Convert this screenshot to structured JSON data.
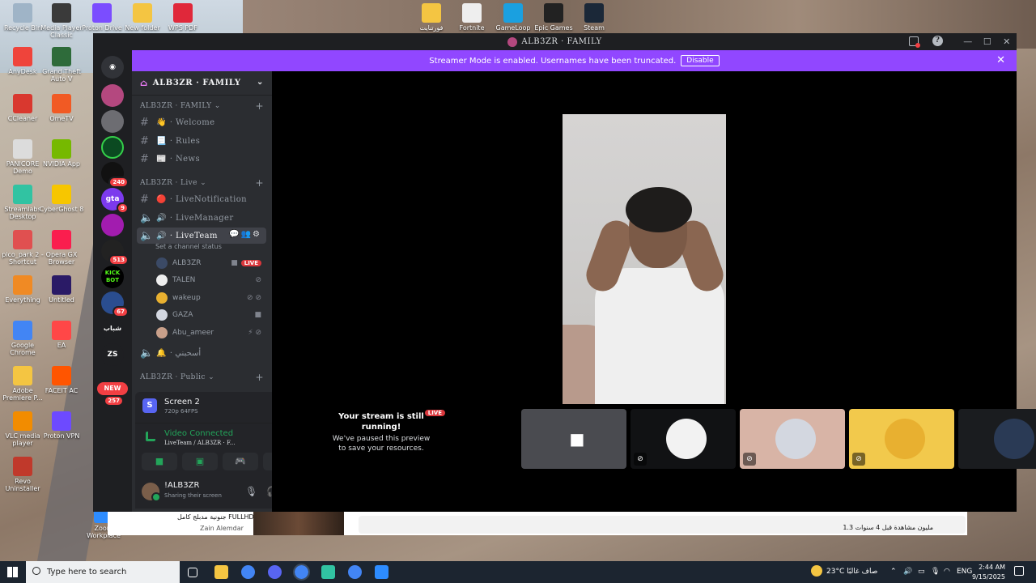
{
  "desktop": {
    "icons": [
      {
        "label": "Recycle Bin",
        "color": "#9fb4c7"
      },
      {
        "label": "Media Player Classic",
        "color": "#3a3a3a"
      },
      {
        "label": "Proton Drive",
        "color": "#7b4dff"
      },
      {
        "label": "New folder",
        "color": "#f4c542"
      },
      {
        "label": "WPS PDF",
        "color": "#e0283a"
      },
      {
        "label": "AnyDesk",
        "color": "#ef443b"
      },
      {
        "label": "Grand Theft Auto V",
        "color": "#2e6b3a"
      },
      {
        "label": "CCleaner",
        "color": "#d9382f"
      },
      {
        "label": "OmeTV",
        "color": "#f15a24"
      },
      {
        "label": "PANICORE Demo",
        "color": "#dcdcdc"
      },
      {
        "label": "NVIDIA App",
        "color": "#76b900"
      },
      {
        "label": "Streamlabs Desktop",
        "color": "#31c3a2"
      },
      {
        "label": "CyberGhost 8",
        "color": "#f7c600"
      },
      {
        "label": "pico_park 2 - Shortcut",
        "color": "#e05050"
      },
      {
        "label": "Opera GX Browser",
        "color": "#fa1e4e"
      },
      {
        "label": "Everything",
        "color": "#f08a24"
      },
      {
        "label": "Untitled",
        "color": "#2a1a66"
      },
      {
        "label": "Google Chrome",
        "color": "#4285f4"
      },
      {
        "label": "EA",
        "color": "#ff4747"
      },
      {
        "label": "Adobe Premiere P...",
        "color": "#f4c542"
      },
      {
        "label": "FACEIT AC",
        "color": "#ff5500"
      },
      {
        "label": "VLC media player",
        "color": "#f28c00"
      },
      {
        "label": "Proton VPN",
        "color": "#6d4aff"
      },
      {
        "label": "Revo Uninstaller",
        "color": "#c0392b"
      },
      {
        "label": "Zoom Workplace",
        "color": "#2d8cff"
      },
      {
        "label": "فورتنايت",
        "color": "#f4c542"
      },
      {
        "label": "Fortnite",
        "color": "#eeeeee"
      },
      {
        "label": "GameLoop",
        "color": "#1aa0e0"
      },
      {
        "label": "Epic Games",
        "color": "#222222"
      },
      {
        "label": "Steam",
        "color": "#1b2838"
      }
    ]
  },
  "window": {
    "title": "ALB3ZR · FAMILY",
    "banner_text": "Streamer Mode is enabled. Usernames have been truncated.",
    "banner_button": "Disable",
    "accent": "#9147ff"
  },
  "rail": {
    "badges": [
      "240",
      "9",
      "513",
      "67",
      "257"
    ],
    "new_label": "NEW",
    "text_guilds": [
      "KICK BOT",
      "شباب",
      "ZS"
    ]
  },
  "server": {
    "name": "ALB3ZR · FAMILY",
    "categories": [
      {
        "label": "ALB3ZR · FAMILY"
      },
      {
        "label": "ALB3ZR · Live"
      },
      {
        "label": "ALB3ZR · Public"
      }
    ],
    "channels": [
      {
        "label": "· Welcome",
        "emoji": "👋"
      },
      {
        "label": "· Rules",
        "emoji": "📃"
      },
      {
        "label": "· News",
        "emoji": "📰"
      },
      {
        "label": "· LiveNotification",
        "emoji": "🔴"
      },
      {
        "label": "· LiveManager",
        "emoji": "🔊"
      },
      {
        "label": "· LiveTeam",
        "emoji": "🔊"
      },
      {
        "label": "· أسحبني",
        "emoji": "🔔"
      }
    ],
    "channel_status": "Set a channel status",
    "voice_users": [
      {
        "name": "ALB3ZR",
        "live": "LIVE"
      },
      {
        "name": "TALEN"
      },
      {
        "name": "wakeup"
      },
      {
        "name": "GAZA"
      },
      {
        "name": "Abu_ameer"
      }
    ]
  },
  "screen_panel": {
    "title": "Screen 2",
    "sub": "720p 64FPS"
  },
  "voice_panel": {
    "status": "Video Connected",
    "channel": "LiveTeam / ALB3ZR · F..."
  },
  "user": {
    "name": "!ALB3ZR",
    "status": "Sharing their screen"
  },
  "stage": {
    "paused_title": "Your stream is still running!",
    "paused_body": "We've paused this preview to save your resources.",
    "live_label": "LIVE",
    "tiles": [
      {
        "bg": "#4a4b50",
        "avatar": "#6b6e74"
      },
      {
        "bg": "#111214",
        "avatar": "#f2f2f2"
      },
      {
        "bg": "#d8b4a6",
        "avatar": "#d3d7e0"
      },
      {
        "bg": "#f2c94c",
        "avatar": "#e8b030"
      },
      {
        "bg": "#1a1c1f",
        "avatar": "#2a3a55"
      }
    ]
  },
  "behind": {
    "video_title": "جنونية مدبلج كامل FULLHD",
    "channel": "Zain Alemdar",
    "views": "1.3 مليون مشاهدة قبل 4 سنوات"
  },
  "taskbar": {
    "search_placeholder": "Type here to search",
    "weather": "23°C  صاف غالبًا",
    "lang": "ENG",
    "time": "2:44 AM",
    "date": "9/15/2025"
  }
}
